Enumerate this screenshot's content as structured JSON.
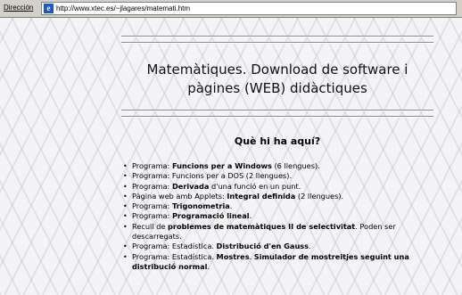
{
  "browser": {
    "address_label": "Dirección",
    "url": "http://www.xtec.es/~jlagares/matemati.htm"
  },
  "page": {
    "title": "Matemàtiques. Download de software i pàgines (WEB) didàctiques",
    "section_heading": "Què hi ha aquí?",
    "items": [
      {
        "a": "Programa: ",
        "b": "Funcions per a Windows",
        "c": " (6 llengues)."
      },
      {
        "a": "Programa: Funcions per a DOS (2 llengues).",
        "b": "",
        "c": ""
      },
      {
        "a": "Programa: ",
        "b": "Derivada",
        "c": " d'una funció en un punt."
      },
      {
        "a": "Pàgina web amb Applets: ",
        "b": "Integral definida",
        "c": " (2 llengues)."
      },
      {
        "a": "Programa: ",
        "b": "Trigonometria",
        "c": "."
      },
      {
        "a": "Programa: ",
        "b": "Programació lineal",
        "c": "."
      },
      {
        "a": "Recull de ",
        "b": "problemes de matemàtiques II de selectivitat",
        "c": ". Poden ser descarregats."
      },
      {
        "a": "Programa: Estadística. ",
        "b": "Distribució d'en Gauss",
        "c": "."
      },
      {
        "a": "Programa: Estadística. ",
        "b": "Mostres",
        "c": ". ",
        "d": "Simulador de mostreitjes seguint una distribució normal",
        "e": "."
      }
    ]
  }
}
